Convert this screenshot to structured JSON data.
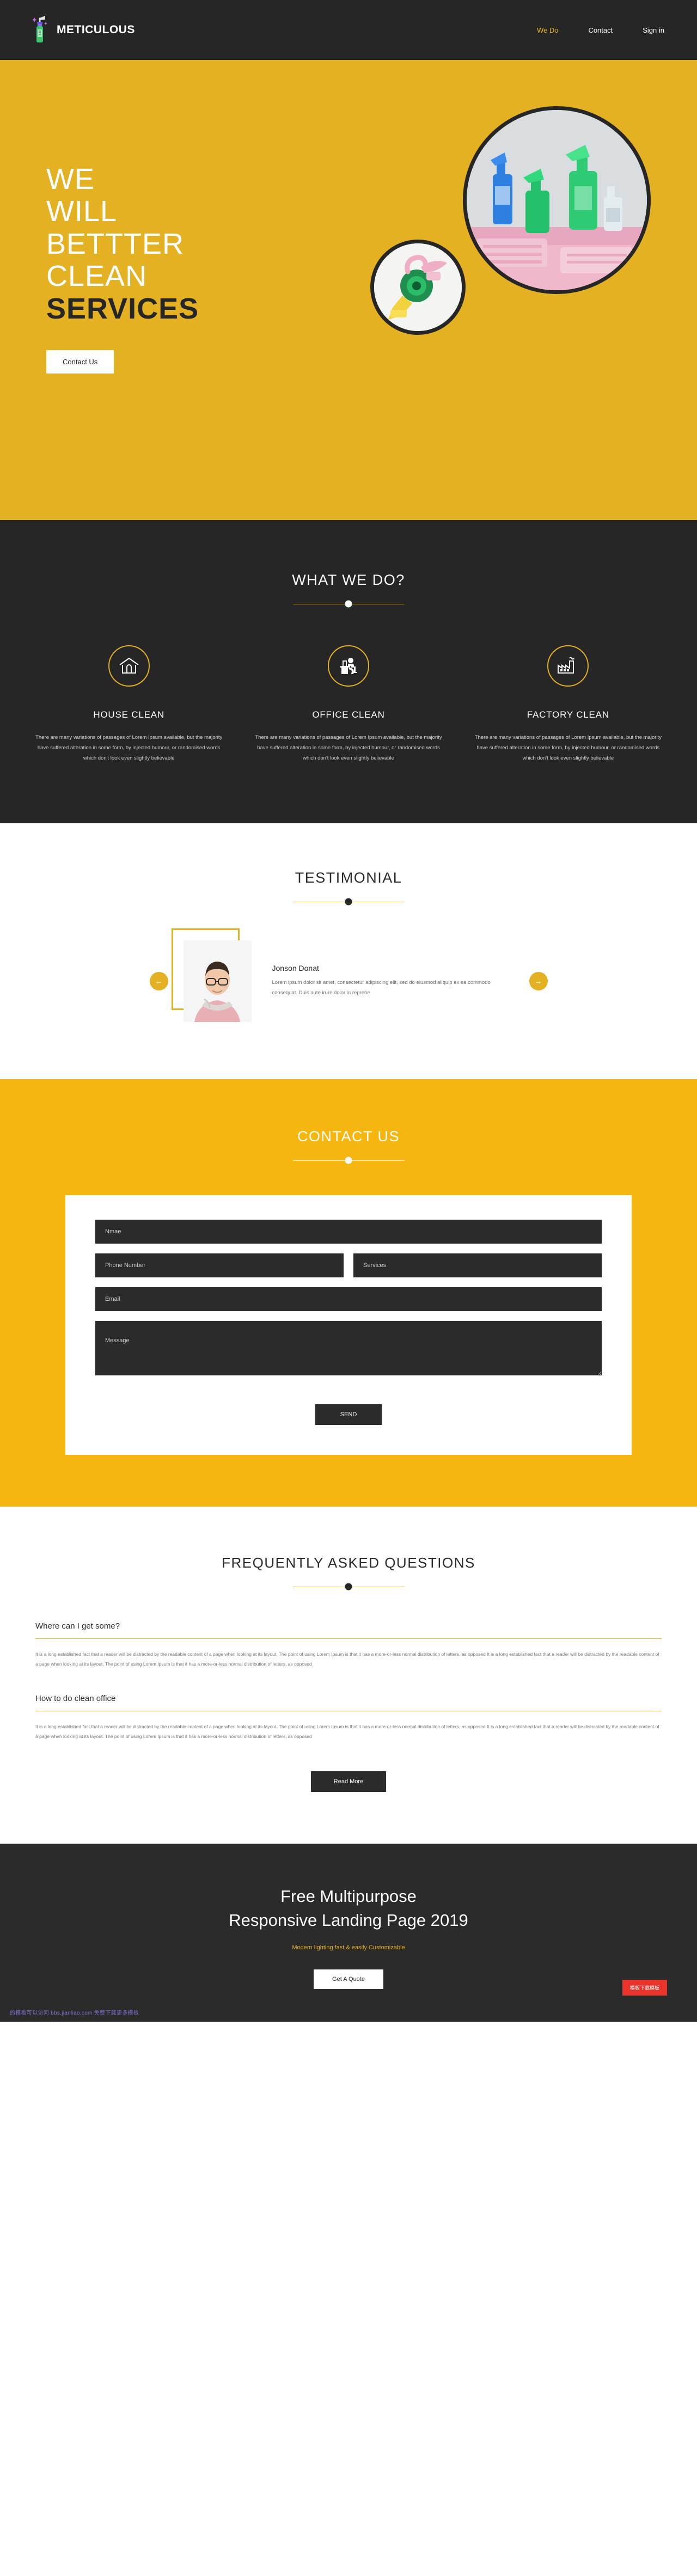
{
  "header": {
    "brand": "METICULOUS",
    "logo_icon": "spray-bottle-icon",
    "nav": [
      {
        "label": "We Do",
        "active": true
      },
      {
        "label": "Contact",
        "active": false
      },
      {
        "label": "Sign in",
        "active": false
      }
    ]
  },
  "hero": {
    "line1": "WE",
    "line2": "WILL",
    "line3": "BETTTER",
    "line4": "CLEAN",
    "line5": "SERVICES",
    "cta": "Contact Us",
    "bg_color": "#e3b122",
    "image_large": "cleaning-supplies-photo",
    "image_small": "spray-bottle-photo"
  },
  "services": {
    "title": "WHAT WE DO?",
    "cards": [
      {
        "icon": "house-icon",
        "title": "HOUSE CLEAN",
        "body": "There are many variations of passages of Lorem Ipsum available, but the majority have suffered alteration in some form, by injected humour, or randomised words which don't look even slightly believable"
      },
      {
        "icon": "office-desk-icon",
        "title": "OFFICE CLEAN",
        "body": "There are many variations of passages of Lorem Ipsum available, but the majority have suffered alteration in some form, by injected humour, or randomised words which don't look even slightly believable"
      },
      {
        "icon": "factory-icon",
        "title": "FACTORY CLEAN",
        "body": "There are many variations of passages of Lorem Ipsum available, but the majority have suffered alteration in some form, by injected humour, or randomised words which don't look even slightly believable"
      }
    ]
  },
  "testimonial": {
    "title": "TESTIMONIAL",
    "prev_icon": "arrow-left-icon",
    "next_icon": "arrow-right-icon",
    "photo": "man-portrait-photo",
    "name": "Jonson Donat",
    "quote": "Lorem ipsum dolor sit amet, consectetur adipiscing elit, sed do eiusmod aliquip ex ea commodo consequat. Duis aute irure dolor in reprehe"
  },
  "contact": {
    "title": "CONTACT US",
    "bg_color": "#f5b60f",
    "fields": {
      "name_placeholder": "Nmae",
      "phone_placeholder": "Phone Number",
      "services_placeholder": "Services",
      "email_placeholder": "Email",
      "message_placeholder": "Message"
    },
    "submit_label": "SEND"
  },
  "faq": {
    "title": "FREQUENTLY ASKED QUESTIONS",
    "items": [
      {
        "question": "Where can I get some?",
        "answer": "It is a long established fact that a reader will be distracted by the readable content of a page when looking at its layout. The point of using Lorem Ipsum is that it has a more-or-less normal distribution of letters, as opposed It is a long established fact that a reader will be distracted by the readable content of a page when looking at its layout. The point of using Lorem Ipsum is that it has a more-or-less normal distribution of letters, as opposed"
      },
      {
        "question": "How to do clean office",
        "answer": "It is a long established fact that a reader will be distracted by the readable content of a page when looking at its layout. The point of using Lorem Ipsum is that it has a more-or-less normal distribution of letters, as opposed It is a long established fact that a reader will be distracted by the readable content of a page when looking at its layout. The point of using Lorem Ipsum is that it has a more-or-less normal distribution of letters, as opposed"
      }
    ],
    "read_more_label": "Read More"
  },
  "footer": {
    "heading_line1": "Free Multipurpose",
    "heading_line2": "Responsive Landing Page 2019",
    "subtitle": "Modern lighting fast & easily Customizable",
    "quote_label": "Get A Quote",
    "download_label": "模板下载模板",
    "watermark": "的模板可以访问 bbs.jianliao.com 免费下载更多模板"
  },
  "colors": {
    "accent": "#e3b122",
    "contact_bg": "#f5b60f",
    "dark": "#262626",
    "red": "#e8342a"
  }
}
